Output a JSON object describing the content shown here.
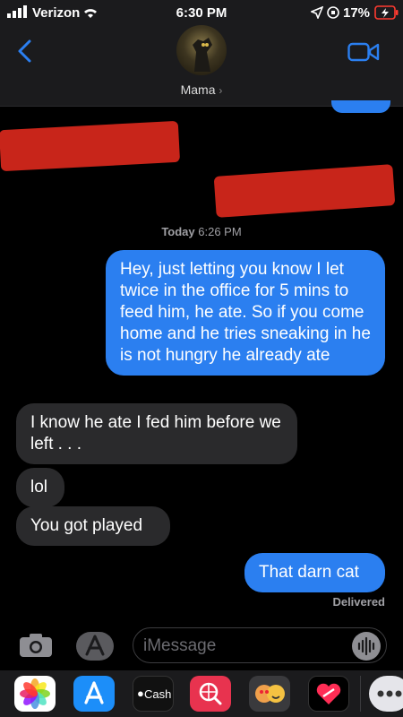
{
  "status_bar": {
    "carrier": "Verizon",
    "time": "6:30 PM",
    "battery": "17%"
  },
  "header": {
    "contact_name": "Mama"
  },
  "thread": {
    "timestamp_day": "Today",
    "timestamp_time": "6:26 PM",
    "messages": [
      {
        "from": "me",
        "text": "Hey, just letting you know I let twice in the office for 5 mins to feed him, he ate. So if you come home and he tries sneaking in he is not hungry he already ate"
      },
      {
        "from": "them",
        "text": "I know he ate I fed him before we left . . ."
      },
      {
        "from": "them",
        "text": "lol"
      },
      {
        "from": "them",
        "text": "You got played"
      },
      {
        "from": "me",
        "text": "That darn cat"
      }
    ],
    "delivered_label": "Delivered"
  },
  "composer": {
    "placeholder": "iMessage"
  },
  "app_drawer": {
    "apps": [
      "photos-icon",
      "app-store-icon",
      "cash-icon",
      "search-web-icon",
      "memoji-icon",
      "heart-sticker-icon",
      "more-icon"
    ],
    "cash_label": "Cash"
  }
}
